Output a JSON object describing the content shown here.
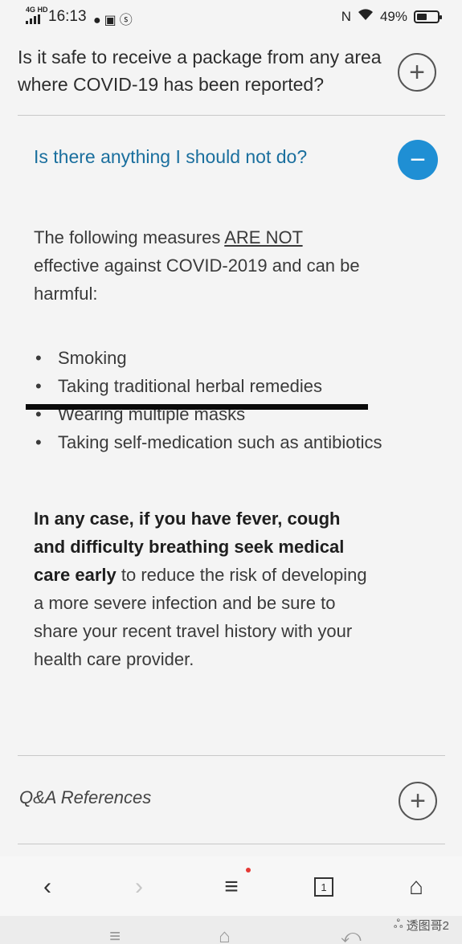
{
  "status_bar": {
    "network": "4G HD",
    "time": "16:13",
    "nfc": "N",
    "battery": "49%",
    "battery_level": 0.49
  },
  "faq": {
    "q1": "Is it safe to receive a package from any area where COVID-19 has been reported?",
    "q2": "Is there anything I should not do?",
    "q2_intro_before": "The following measures ",
    "q2_intro_emph": "ARE NOT",
    "q2_intro_after": " effective against COVID-2019 and can be harmful:",
    "bullets": [
      "Smoking",
      "Taking traditional herbal remedies",
      "Wearing multiple masks",
      "Taking self-medication such as antibiotics"
    ],
    "advice_bold": "In any case, if you have fever, cough and difficulty breathing seek medical care early",
    "advice_rest": " to reduce the risk of developing a more severe infection and be sure to share your recent travel history with your health care provider.",
    "references": "Q&A References"
  },
  "icons": {
    "expand": "+",
    "collapse": "−"
  },
  "browser_nav": {
    "back": "‹",
    "forward": "›",
    "menu": "≡",
    "tabs_count": "1",
    "home": "⌂"
  },
  "watermark": "透图哥2"
}
